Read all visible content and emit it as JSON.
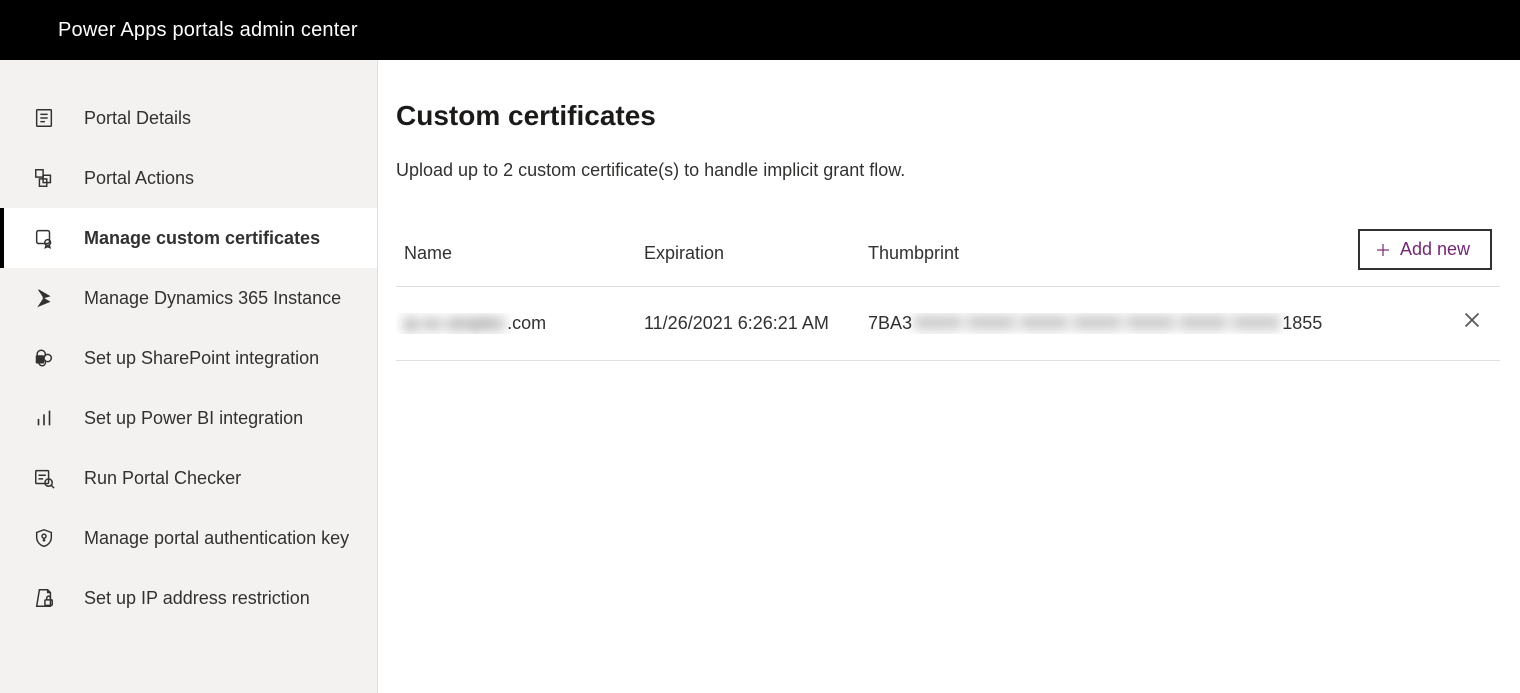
{
  "header": {
    "title": "Power Apps portals admin center"
  },
  "sidebar": {
    "items": [
      {
        "label": "Portal Details",
        "icon": "details-icon"
      },
      {
        "label": "Portal Actions",
        "icon": "actions-icon"
      },
      {
        "label": "Manage custom certificates",
        "icon": "certificate-icon"
      },
      {
        "label": "Manage Dynamics 365 Instance",
        "icon": "dynamics-icon"
      },
      {
        "label": "Set up SharePoint integration",
        "icon": "sharepoint-icon"
      },
      {
        "label": "Set up Power BI integration",
        "icon": "powerbi-icon"
      },
      {
        "label": "Run Portal Checker",
        "icon": "checker-icon"
      },
      {
        "label": "Manage portal authentication key",
        "icon": "auth-key-icon"
      },
      {
        "label": "Set up IP address restriction",
        "icon": "ip-restriction-icon"
      }
    ],
    "active_index": 2
  },
  "main": {
    "title": "Custom certificates",
    "description": "Upload up to 2 custom certificate(s) to handle implicit grant flow.",
    "add_button_label": "Add new",
    "columns": {
      "name": "Name",
      "expiration": "Expiration",
      "thumbprint": "Thumbprint"
    },
    "rows": [
      {
        "name_prefix_hidden": "ip ex amples",
        "name_suffix": ".com",
        "expiration": "11/26/2021 6:26:21 AM",
        "thumbprint_prefix": "7BA3",
        "thumbprint_hidden": "XXXX XXXX XXXX XXXX XXXX XXXX XXXX",
        "thumbprint_suffix": "1855"
      }
    ]
  }
}
